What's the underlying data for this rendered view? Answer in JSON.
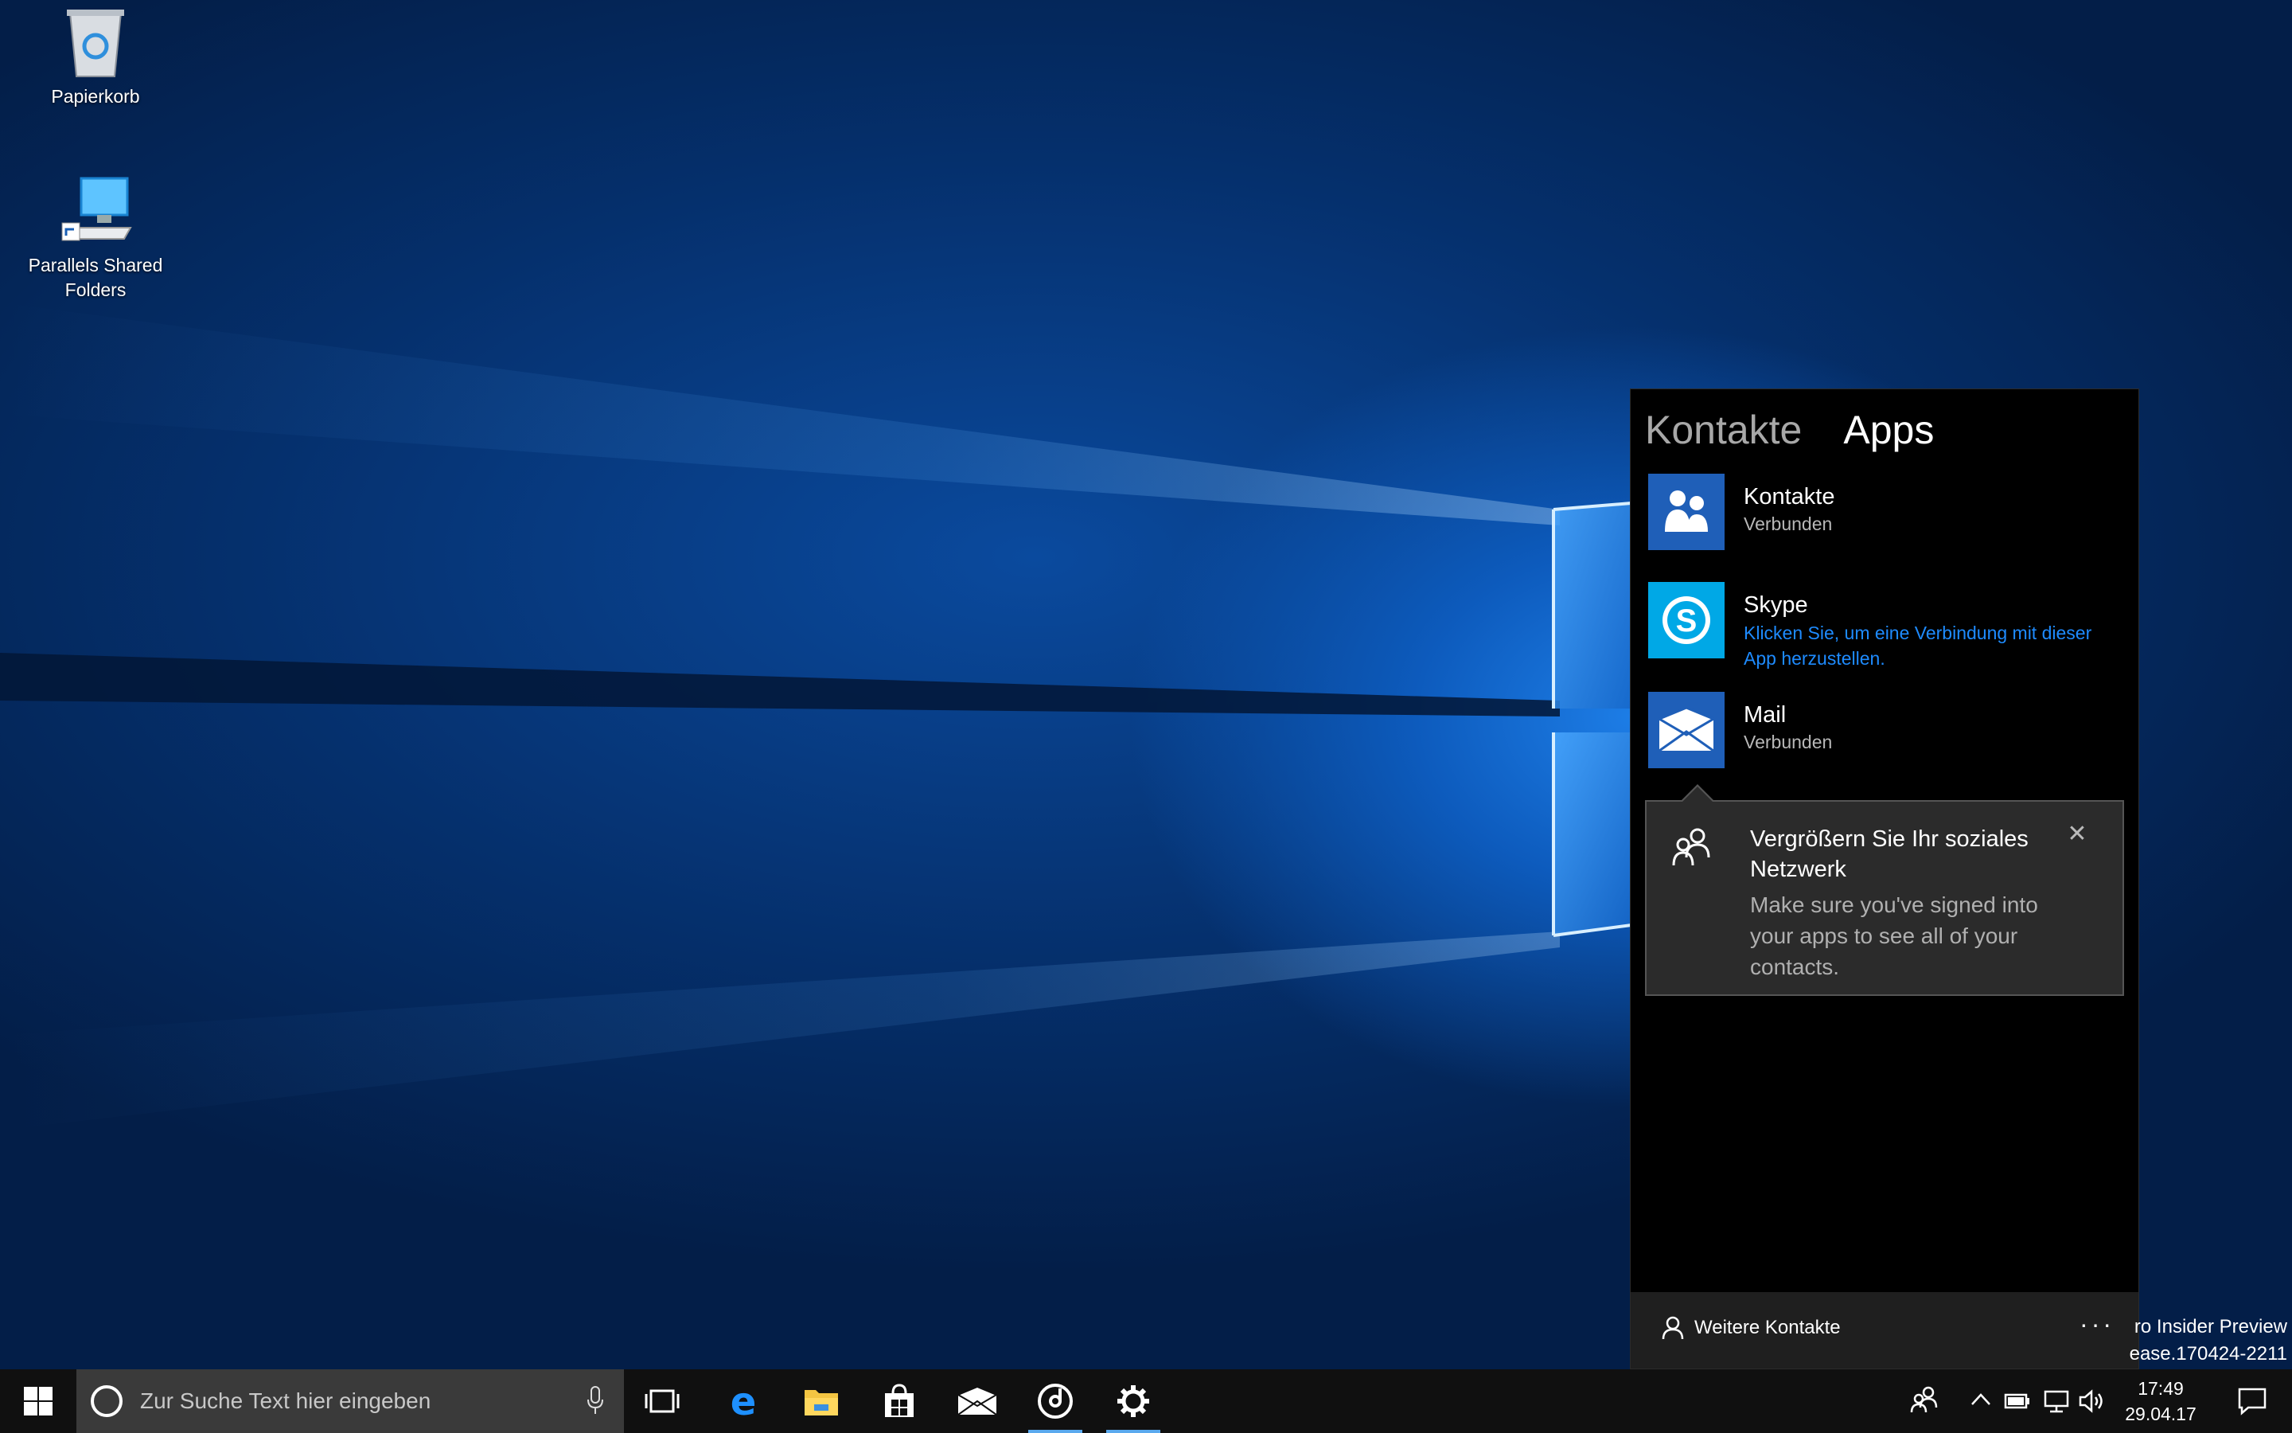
{
  "desktop": {
    "icons": [
      {
        "label": "Papierkorb",
        "icon": "recycle-bin-icon"
      },
      {
        "label": "Parallels Shared Folders",
        "icon": "shared-folders-icon"
      }
    ]
  },
  "people_flyout": {
    "tabs": [
      {
        "label": "Kontakte",
        "active": false
      },
      {
        "label": "Apps",
        "active": true
      }
    ],
    "apps": [
      {
        "name": "Kontakte",
        "status": "Verbunden",
        "icon": "people-icon",
        "color": "#1f5fb8"
      },
      {
        "name": "Skype",
        "status": "Klicken Sie, um eine Verbindung mit dieser App herzustellen.",
        "icon": "skype-icon",
        "color": "#00a8e6"
      },
      {
        "name": "Mail",
        "status": "Verbunden",
        "icon": "mail-icon",
        "color": "#1f5fb8"
      }
    ],
    "tip": {
      "title": "Vergrößern Sie Ihr soziales Netzwerk",
      "body": "Make sure you've signed into your apps to see all of your contacts.",
      "close": "✕"
    },
    "footer": {
      "link_label": "Weitere Kontakte",
      "more": "···"
    }
  },
  "watermark": {
    "line1": "ro Insider Preview",
    "line2": "ease.170424-2211"
  },
  "taskbar": {
    "search_placeholder": "Zur Suche Text hier eingeben",
    "pinned": [
      "task-view-icon",
      "edge-icon",
      "file-explorer-icon",
      "store-icon",
      "mail-icon",
      "groove-music-icon",
      "settings-icon"
    ],
    "clock_time": "17:49",
    "clock_date": "29.04.17",
    "accent": "#5aa9ee"
  }
}
